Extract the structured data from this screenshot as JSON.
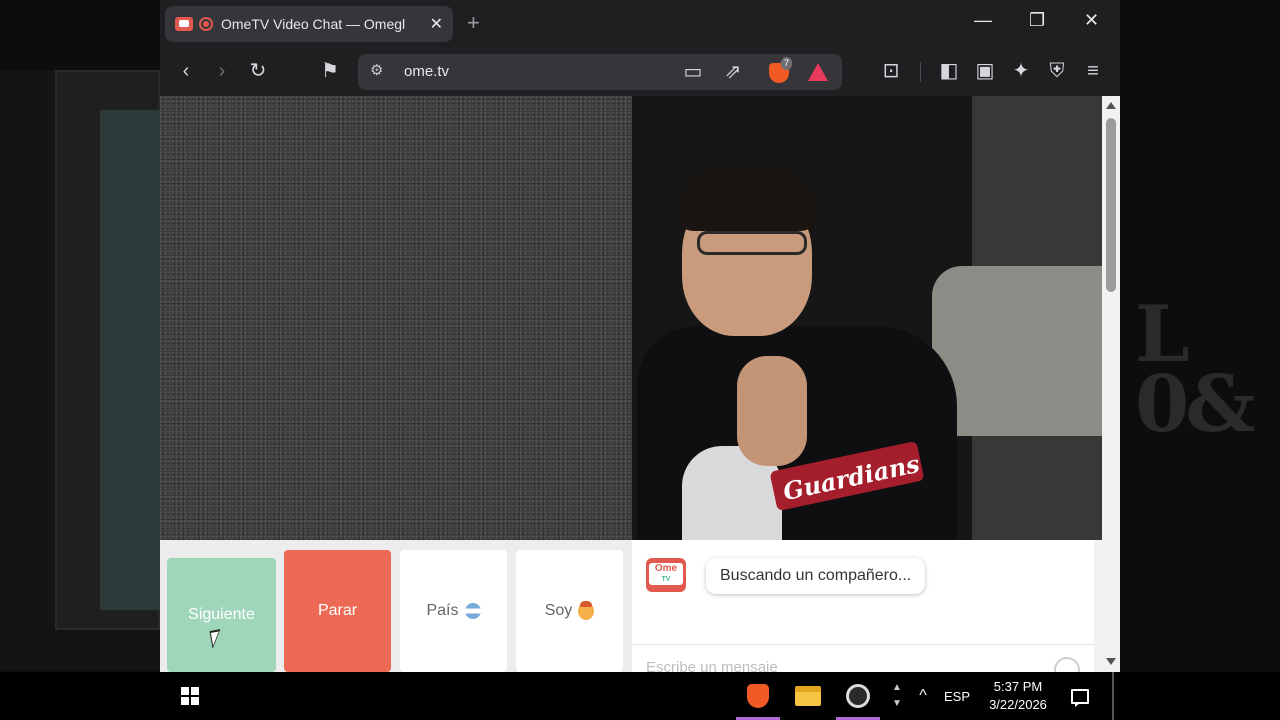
{
  "browser": {
    "tab_title": "OmeTV Video Chat — Omegl",
    "new_tab_label": "+",
    "tab_close_label": "✕",
    "window_controls": {
      "minimize": "—",
      "maximize": "❐",
      "close": "✕"
    },
    "url": "ome.tv",
    "shield_badge": "7"
  },
  "page": {
    "controls": {
      "next_label": "Siguiente",
      "stop_label": "Parar",
      "country_label": "País",
      "me_label": "Soy"
    },
    "chat": {
      "logo_line1": "Ome",
      "logo_line2": "TV",
      "status_message": "Buscando un compañero...",
      "input_placeholder": "Escribe un mensaje"
    }
  },
  "background": {
    "logo_text_line1": "L",
    "logo_text_line2": "0&"
  },
  "video": {
    "shirt_text": "Guardians"
  },
  "taskbar": {
    "language": "ESP",
    "time": "5:37 PM",
    "date": "3/22/2026"
  },
  "colors": {
    "next_button": "#9fd6ba",
    "stop_button": "#ec6a55",
    "brand_red": "#e25a4f",
    "brave_orange": "#f15a24"
  }
}
